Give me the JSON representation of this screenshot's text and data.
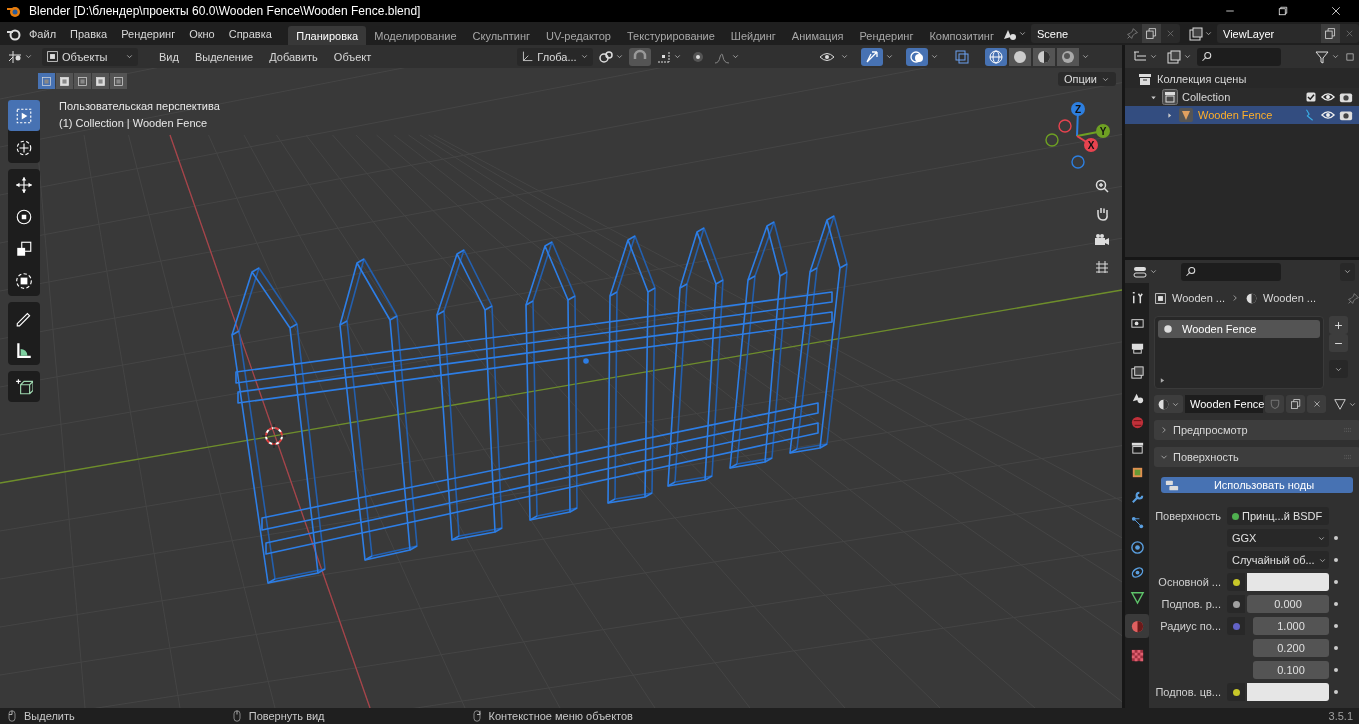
{
  "window": {
    "title": "Blender [D:\\блендер\\проекты 60.0\\Wooden Fence\\Wooden Fence.blend]"
  },
  "menu": [
    "Файл",
    "Правка",
    "Рендеринг",
    "Окно",
    "Справка"
  ],
  "workspaces": [
    {
      "label": "Планировка",
      "selected": true
    },
    {
      "label": "Моделирование",
      "selected": false
    },
    {
      "label": "Скульптинг",
      "selected": false
    },
    {
      "label": "UV-редактор",
      "selected": false
    },
    {
      "label": "Текстурирование",
      "selected": false
    },
    {
      "label": "Шейдинг",
      "selected": false
    },
    {
      "label": "Анимация",
      "selected": false
    },
    {
      "label": "Рендеринг",
      "selected": false
    },
    {
      "label": "Композитинг",
      "selected": false
    }
  ],
  "scene": {
    "name": "Scene"
  },
  "view_layer": {
    "name": "ViewLayer"
  },
  "viewport_header": {
    "mode": "Объекты",
    "menus": [
      "Вид",
      "Выделение",
      "Добавить",
      "Объект"
    ],
    "orientation": "Глоба...",
    "toggles": [
      {
        "kind": "visibility",
        "on": false
      },
      {
        "kind": "gizmos",
        "on": true
      },
      {
        "kind": "overlays",
        "on": true
      },
      {
        "kind": "xray",
        "on": false
      }
    ],
    "shading": [
      {
        "kind": "wireframe",
        "selected": true
      },
      {
        "kind": "solid",
        "selected": false
      },
      {
        "kind": "material",
        "selected": false
      },
      {
        "kind": "rendered",
        "selected": false
      }
    ]
  },
  "select_modes": [
    {
      "selected": true
    },
    {
      "selected": false
    },
    {
      "selected": false
    },
    {
      "selected": false
    },
    {
      "selected": false
    }
  ],
  "options_button": "Опции",
  "viewport": {
    "view_name": "Пользовательская перспектива",
    "object_info": "(1) Collection | Wooden Fence"
  },
  "gizmo_axes": [
    {
      "label": "Z",
      "color": "#2d7fe0"
    },
    {
      "label": "Y",
      "color": "#6ea023"
    },
    {
      "label": "X",
      "color": "#e8434f"
    }
  ],
  "tools": [
    {
      "kind": "select_box",
      "selected": true
    },
    {
      "kind": "cursor",
      "selected": false
    },
    {
      "kind": "move",
      "selected": false
    },
    {
      "kind": "rotate",
      "selected": false
    },
    {
      "kind": "scale",
      "selected": false
    },
    {
      "kind": "transform",
      "selected": false
    },
    {
      "kind": "annotate",
      "selected": false
    },
    {
      "kind": "measure",
      "selected": false
    },
    {
      "kind": "add_cube",
      "selected": false
    }
  ],
  "outliner": {
    "items": [
      {
        "label": "Коллекция сцены",
        "kind": "scene_collection",
        "children": [
          {
            "label": "Collection",
            "kind": "collection",
            "expanded": true,
            "checked": true,
            "selected": false,
            "children": [
              {
                "label": "Wooden Fence",
                "kind": "mesh",
                "expanded": false,
                "selected": true
              }
            ]
          }
        ]
      }
    ]
  },
  "property_tabs": [
    {
      "kind": "tool",
      "selected": false
    },
    {
      "kind": "render",
      "selected": false
    },
    {
      "kind": "output",
      "selected": false
    },
    {
      "kind": "view_layer",
      "selected": false
    },
    {
      "kind": "scene",
      "selected": false
    },
    {
      "kind": "world",
      "selected": false
    },
    {
      "kind": "collection",
      "selected": false
    },
    {
      "kind": "object",
      "selected": false
    },
    {
      "kind": "modifiers",
      "selected": false
    },
    {
      "kind": "particles",
      "selected": false
    },
    {
      "kind": "physics",
      "selected": false
    },
    {
      "kind": "constraints",
      "selected": false
    },
    {
      "kind": "data",
      "selected": false
    },
    {
      "kind": "material",
      "selected": true
    },
    {
      "kind": "texture",
      "selected": false
    }
  ],
  "properties": {
    "breadcrumb": [
      "Wooden ...",
      "Wooden ..."
    ],
    "material_slots": [
      {
        "label": "Wooden Fence",
        "selected": true
      }
    ],
    "material_name": "Wooden Fence",
    "panels": [
      {
        "label": "Предпросмотр",
        "expanded": false
      },
      {
        "label": "Поверхность",
        "expanded": true
      }
    ],
    "use_nodes_button": "Использовать ноды",
    "rows": [
      {
        "kind": "link",
        "label": "Поверхность",
        "color": "#4fb04f",
        "value": "Принц...й BSDF"
      },
      {
        "kind": "dropdown",
        "value": "GGX"
      },
      {
        "kind": "dropdown",
        "value": "Случайный об..."
      },
      {
        "kind": "color",
        "label": "Основной ...",
        "socket": {
          "color": "#c7c729"
        },
        "swatch": {
          "color": "#e6e6e6"
        }
      },
      {
        "kind": "number",
        "label": "Подпов. р...",
        "color": "#a1a1a1",
        "value": "0.000"
      },
      {
        "kind": "vector",
        "label": "Радиус по...",
        "color": "#6363c7",
        "values": [
          "1.000",
          "0.200",
          "0.100"
        ]
      },
      {
        "kind": "color",
        "label": "Подпов. цв...",
        "socket": {
          "color": "#c7c729"
        },
        "swatch": {
          "color": "#e6e6e6"
        }
      }
    ]
  },
  "status_bar": {
    "hints": [
      "Выделить",
      "Повернуть вид",
      "Контекстное меню объектов"
    ],
    "version": "3.5.1"
  }
}
